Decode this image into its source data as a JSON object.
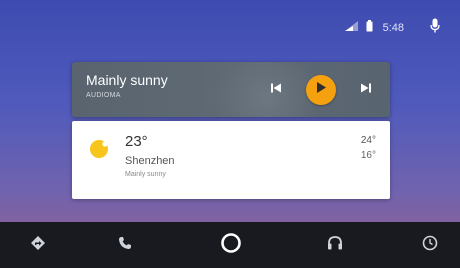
{
  "status_bar": {
    "time": "5:48",
    "icons": [
      "signal-icon",
      "battery-icon"
    ],
    "mic_icon": "mic-icon"
  },
  "media_card": {
    "title": "Mainly sunny",
    "subtitle": "AUDIOMA",
    "accent_color": "#f5a00f",
    "controls": [
      "skip-previous-icon",
      "play-icon",
      "skip-next-icon"
    ]
  },
  "weather_card": {
    "icon": "sun-icon",
    "temperature": "23°",
    "city": "Shenzhen",
    "condition": "Mainly sunny",
    "high": "24°",
    "low": "16°",
    "icon_color": "#f7c51c"
  },
  "nav_bar": {
    "items": [
      "navigation-icon",
      "phone-icon",
      "home-icon",
      "headphones-icon",
      "clock-icon"
    ]
  }
}
